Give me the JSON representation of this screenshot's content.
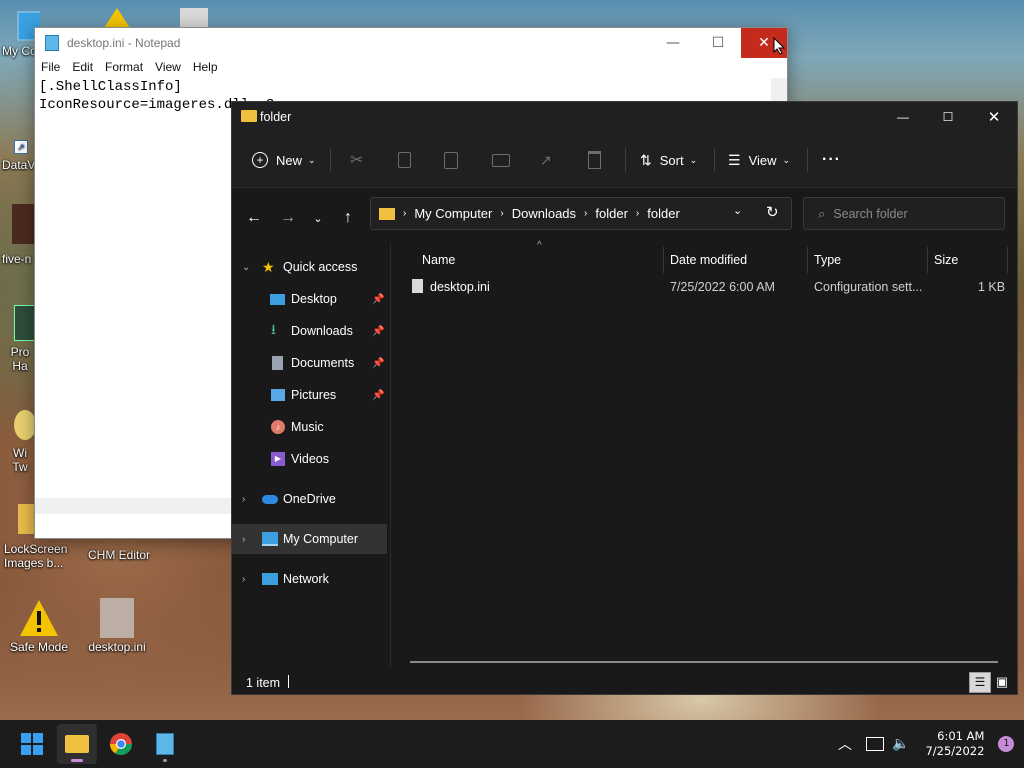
{
  "desktop": {
    "icons": [
      {
        "label": "My Co"
      },
      {
        "label": "DataV"
      },
      {
        "label": "five-n"
      },
      {
        "label": "Pro\nHa"
      },
      {
        "label": "Wi\nTw"
      },
      {
        "label": "LockScreen\nImages b..."
      },
      {
        "label": "CHM Editor"
      },
      {
        "label": "Safe Mode"
      },
      {
        "label": "desktop.ini"
      }
    ]
  },
  "notepad": {
    "title": "desktop.ini - Notepad",
    "menu": [
      "File",
      "Edit",
      "Format",
      "View",
      "Help"
    ],
    "lines": [
      "[.ShellClassInfo]",
      "IconResource=imageres.dll,-3"
    ]
  },
  "explorer": {
    "title": "folder",
    "toolbar": {
      "new_label": "New",
      "sort_label": "Sort",
      "view_label": "View",
      "more_label": "···"
    },
    "breadcrumb": [
      "My Computer",
      "Downloads",
      "folder",
      "folder"
    ],
    "search_placeholder": "Search folder",
    "nav": {
      "quick_access": "Quick access",
      "items": [
        {
          "label": "Desktop",
          "pinned": true
        },
        {
          "label": "Downloads",
          "pinned": true
        },
        {
          "label": "Documents",
          "pinned": true
        },
        {
          "label": "Pictures",
          "pinned": true
        },
        {
          "label": "Music",
          "pinned": false
        },
        {
          "label": "Videos",
          "pinned": false
        }
      ],
      "onedrive": "OneDrive",
      "my_computer": "My Computer",
      "network": "Network"
    },
    "columns": [
      "Name",
      "Date modified",
      "Type",
      "Size"
    ],
    "files": [
      {
        "name": "desktop.ini",
        "date": "7/25/2022 6:00 AM",
        "type": "Configuration sett...",
        "size": "1 KB"
      }
    ],
    "status": "1 item"
  },
  "taskbar": {
    "time": "6:01 AM",
    "date": "7/25/2022",
    "notification_count": "1"
  },
  "colors": {
    "accent_close": "#c42b1c",
    "explorer_bg": "#191919",
    "taskbar_bg": "#1c1c1c"
  }
}
